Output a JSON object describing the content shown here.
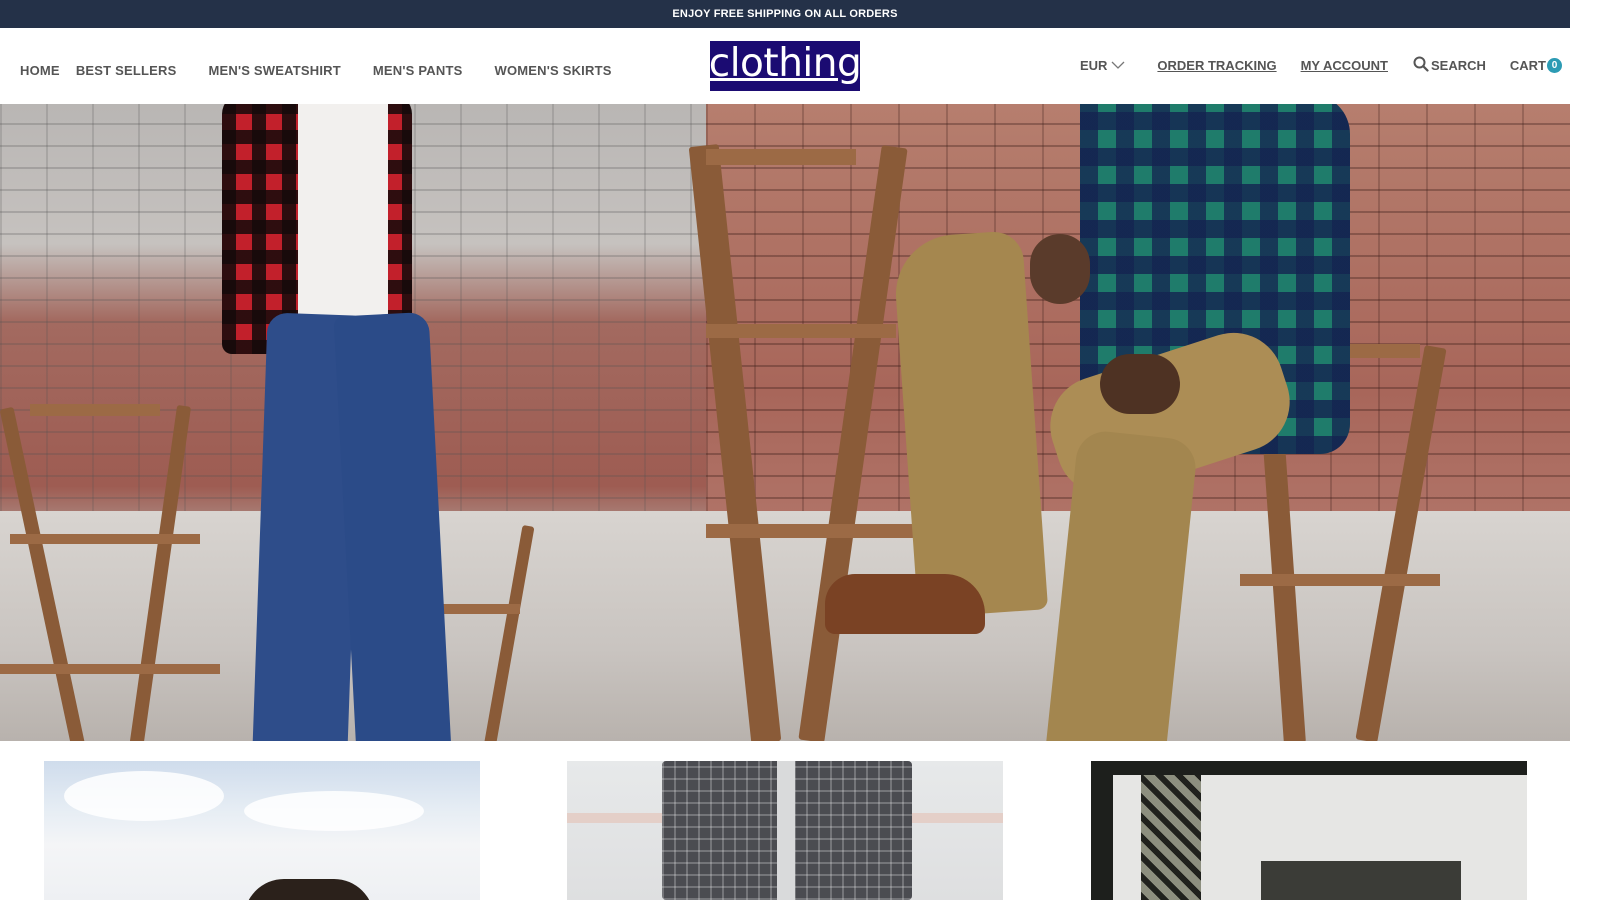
{
  "announcement": "ENJOY FREE SHIPPING ON ALL ORDERS",
  "logo": {
    "text": "clothing",
    "bg_color": "#1b0b72"
  },
  "nav": {
    "left": [
      {
        "label": "HOME"
      },
      {
        "label": "BEST SELLERS"
      },
      {
        "label": "MEN'S SWEATSHIRT"
      },
      {
        "label": "MEN'S PANTS"
      },
      {
        "label": "WOMEN'S SKIRTS"
      }
    ],
    "currency": {
      "value": "EUR",
      "icon": "chevron-down-icon"
    },
    "order_tracking": "ORDER TRACKING",
    "my_account": "MY ACCOUNT",
    "search": {
      "label": "SEARCH",
      "icon": "search-icon"
    },
    "cart": {
      "label": "CART",
      "count": "0",
      "badge_color": "#2c9bb4"
    }
  },
  "colors": {
    "announcement_bg": "#243148",
    "nav_text": "#555555"
  }
}
